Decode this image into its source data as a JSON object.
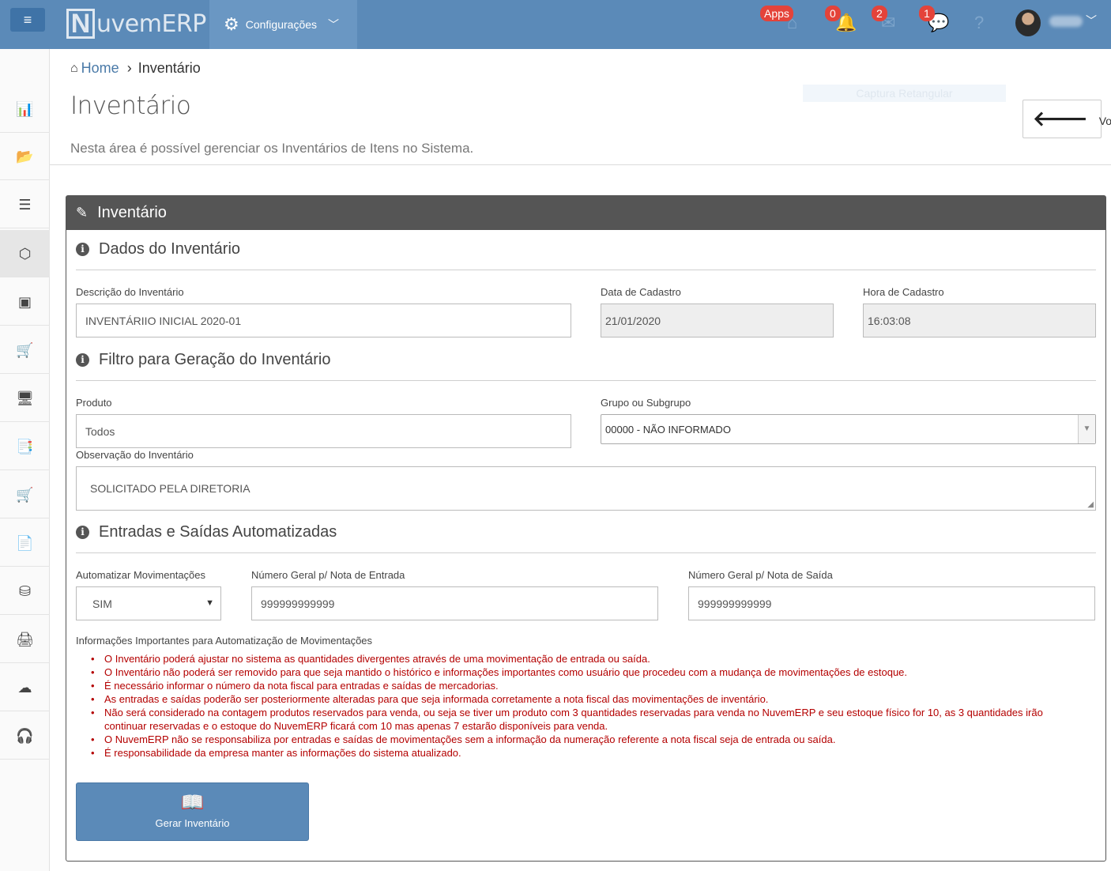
{
  "topbar": {
    "menu_icon": "hamburger-icon",
    "logo_letter": "N",
    "logo_text": "uvemERP",
    "config_label": "Configurações",
    "badges": {
      "apps": "Apps",
      "notifications": "0",
      "messages": "2",
      "chat": "1"
    }
  },
  "sidebar": {
    "items": [
      {
        "icon": "bar-chart-icon",
        "glyph": "📊"
      },
      {
        "icon": "folder-open-icon",
        "glyph": "📂"
      },
      {
        "icon": "list-icon",
        "glyph": "☰"
      },
      {
        "icon": "cube-icon",
        "glyph": "⬡"
      },
      {
        "icon": "frame-icon",
        "glyph": "▣"
      },
      {
        "icon": "cart-icon",
        "glyph": "🛒"
      },
      {
        "icon": "desktop-icon",
        "glyph": "🖥"
      },
      {
        "icon": "documents-icon",
        "glyph": "📑"
      },
      {
        "icon": "shopping-cart-icon",
        "glyph": "🛒"
      },
      {
        "icon": "file-text-icon",
        "glyph": "📄"
      },
      {
        "icon": "database-icon",
        "glyph": "⛁"
      },
      {
        "icon": "print-icon",
        "glyph": "🖨"
      },
      {
        "icon": "cloud-upload-icon",
        "glyph": "☁"
      },
      {
        "icon": "headset-icon",
        "glyph": "🎧"
      }
    ]
  },
  "breadcrumb": {
    "home": "Home",
    "current": "Inventário"
  },
  "page": {
    "title": "Inventário",
    "subtitle": "Nesta área é possível gerenciar os Inventários de Itens no Sistema.",
    "capture_label": "Captura Retangular",
    "back_label": "Voltar"
  },
  "panel": {
    "title": "Inventário",
    "sections": {
      "dados": "Dados do Inventário",
      "filtro": "Filtro para Geração do Inventário",
      "entradas": "Entradas e Saídas Automatizadas"
    },
    "fields": {
      "descricao": {
        "label": "Descrição do Inventário",
        "value": "INVENTÁRIIO INICIAL 2020-01"
      },
      "data_cadastro": {
        "label": "Data de Cadastro",
        "value": "21/01/2020"
      },
      "hora_cadastro": {
        "label": "Hora de Cadastro",
        "value": "16:03:08"
      },
      "produto": {
        "label": "Produto",
        "value": "Todos"
      },
      "grupo": {
        "label": "Grupo ou Subgrupo",
        "value": "00000 - NÃO INFORMADO"
      },
      "observacao": {
        "label": "Observação do Inventário",
        "value": "SOLICITADO PELA DIRETORIA"
      },
      "automatizar": {
        "label": "Automatizar Movimentações",
        "value": "SIM"
      },
      "nota_entrada": {
        "label": "Número Geral p/ Nota de Entrada",
        "value": "999999999999"
      },
      "nota_saida": {
        "label": "Número Geral p/ Nota de Saída",
        "value": "999999999999"
      }
    },
    "info_title": "Informações Importantes para Automatização de Movimentações",
    "warnings": [
      "O Inventário poderá ajustar no sistema as quantidades divergentes através de uma movimentação de entrada ou saída.",
      "O Inventário não poderá ser removido para que seja mantido o histórico e informações importantes como usuário que procedeu com a mudança de movimentações de estoque.",
      "É necessário informar o número da nota fiscal para entradas e saídas de mercadorias.",
      "As entradas e saídas poderão ser posteriormente alteradas para que seja informada corretamente a nota fiscal das movimentações de inventário.",
      "Não será considerado na contagem produtos reservados para venda, ou seja se tiver um produto com 3 quantidades reservadas para venda no NuvemERP e seu estoque físico for 10, as 3 quantidades irão continuar reservadas e o estoque do NuvemERP ficará com 10 mas apenas 7 estarão disponíveis para venda.",
      "O NuvemERP não se responsabiliza por entradas e saídas de movimentações sem a informação da numeração referente a nota fiscal seja de entrada ou saída.",
      "É responsabilidade da empresa manter as informações do sistema atualizado."
    ],
    "submit_label": "Gerar Inventário"
  },
  "colors": {
    "topbar": "#5b8ab8",
    "panel_header": "#555555",
    "warning_text": "#b40000",
    "badge": "#e4433a"
  }
}
